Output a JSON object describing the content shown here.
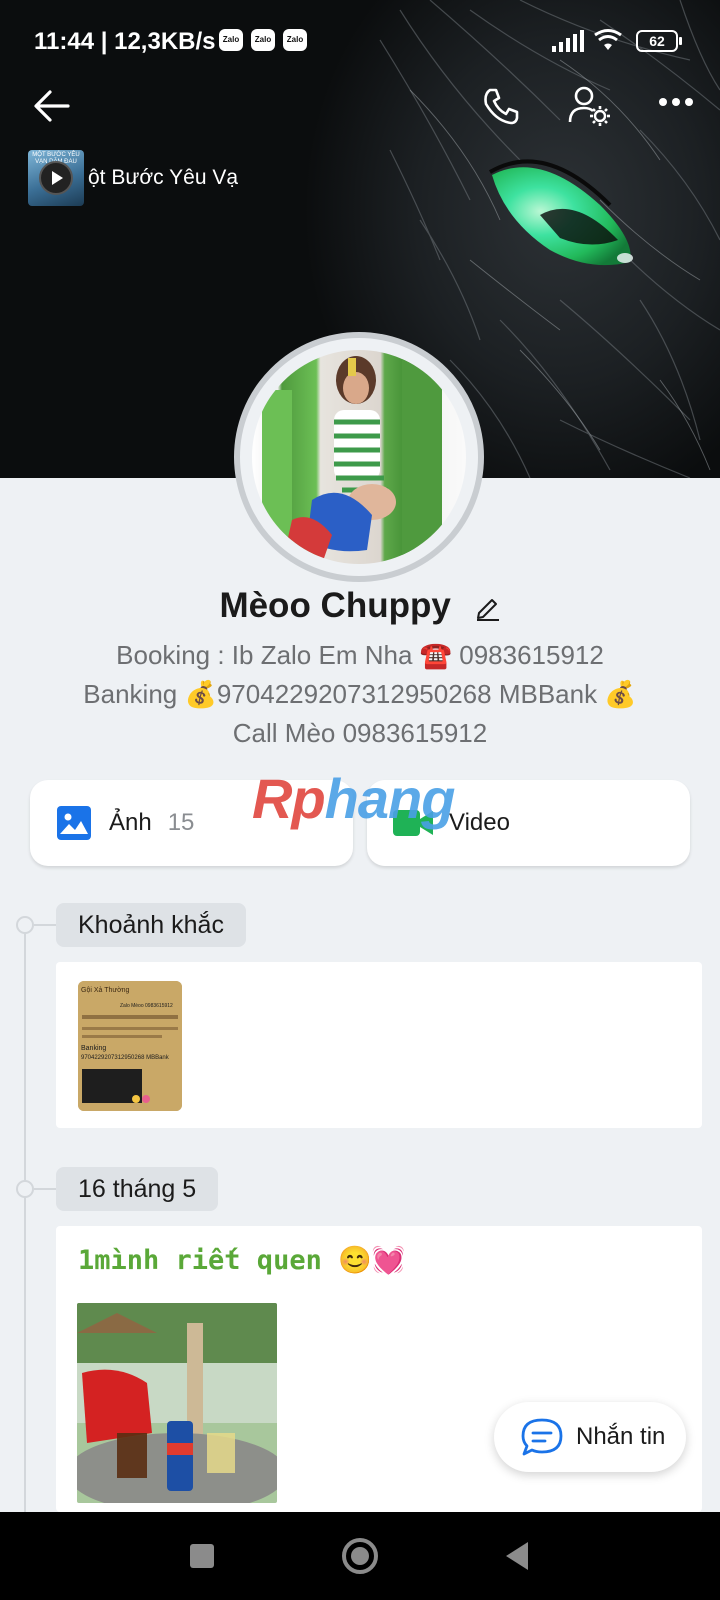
{
  "status_bar": {
    "time": "11:44 | 12,3KB/s",
    "notification_icons": [
      "Zalo",
      "Zalo",
      "Zalo"
    ],
    "battery": "62"
  },
  "music": {
    "title": "ột Bước Yêu Vạ",
    "thumb_caption": "MỘT BƯỚC YÊU VẠN DẶM ĐAU"
  },
  "profile": {
    "name": "Mèoo Chuppy",
    "bio": [
      "Booking : Ib Zalo Em Nha ☎️ 0983615912",
      "Banking 💰9704229207312950268 MBBank 💰",
      "Call Mèo 0983615912"
    ]
  },
  "media": {
    "photos_label": "Ảnh",
    "photos_count": "15",
    "video_label": "Video"
  },
  "watermark": {
    "part1": "Rp",
    "part2": "hang"
  },
  "timeline": {
    "section1": "Khoảnh khắc",
    "section2_date": "16 tháng 5",
    "post_text": "1mình riết quen 😊💓"
  },
  "moment_thumb_text": [
    "Gội Xả Thường",
    "Banking",
    "9704229207312950268 MBBank",
    "Zalo Mèoo 0983615912"
  ],
  "message_button": "Nhắn tin",
  "colors": {
    "accent_blue": "#1a73e8",
    "video_green": "#1fb256",
    "post_green": "#5aa838"
  }
}
